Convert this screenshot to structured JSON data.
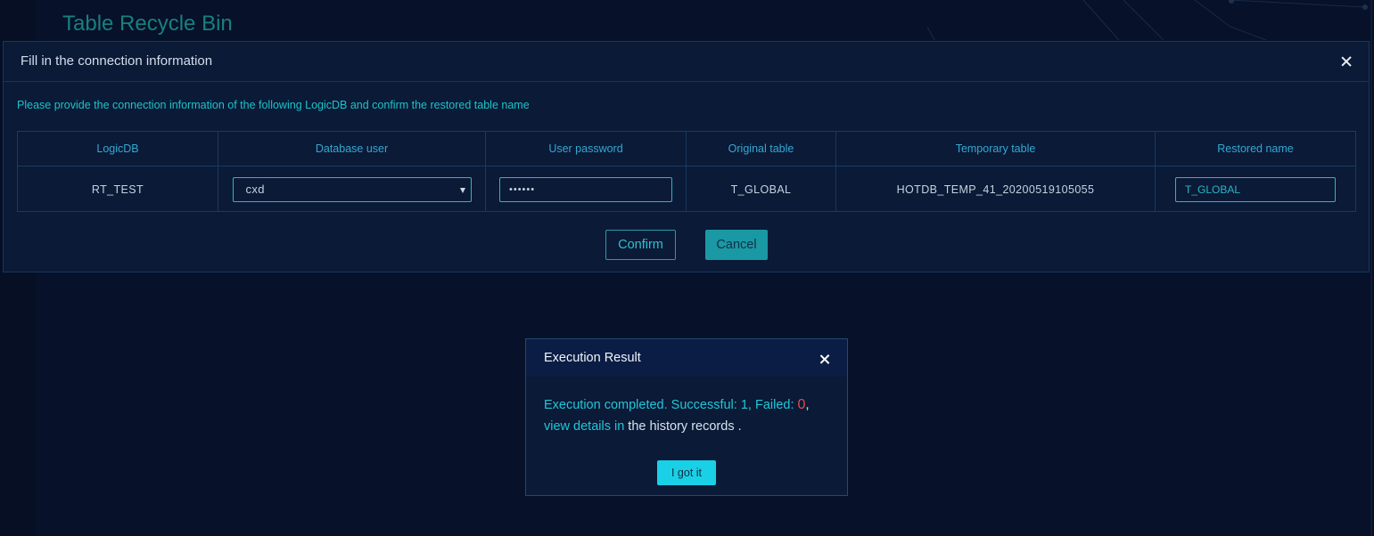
{
  "page": {
    "title": "Table Recycle Bin"
  },
  "connection_dialog": {
    "title": "Fill in the connection information",
    "close_icon": "close-icon",
    "instruction": "Please provide the connection information of the following LogicDB and confirm the restored table name",
    "columns": [
      "LogicDB",
      "Database user",
      "User password",
      "Original table",
      "Temporary table",
      "Restored name"
    ],
    "row": {
      "logicdb": "RT_TEST",
      "database_user": "cxd",
      "user_password": "••••••",
      "original_table": "T_GLOBAL",
      "temporary_table": "HOTDB_TEMP_41_20200519105055",
      "restored_name": "T_GLOBAL"
    },
    "confirm_label": "Confirm",
    "cancel_label": "Cancel"
  },
  "result_dialog": {
    "title": "Execution Result",
    "msg_prefix": "Execution completed. Successful: ",
    "successful": "1",
    "msg_failed_label": ", Failed: ",
    "failed": "0",
    "msg_comma": ",",
    "link_text": "view details in",
    "msg_suffix": " the history records .",
    "button_label": "I got it"
  },
  "colors": {
    "background": "#071129",
    "dialog_bg": "#0a1a37",
    "accent": "#1ad0e6",
    "title_teal": "#17807f",
    "error_red": "#e54b4b"
  }
}
